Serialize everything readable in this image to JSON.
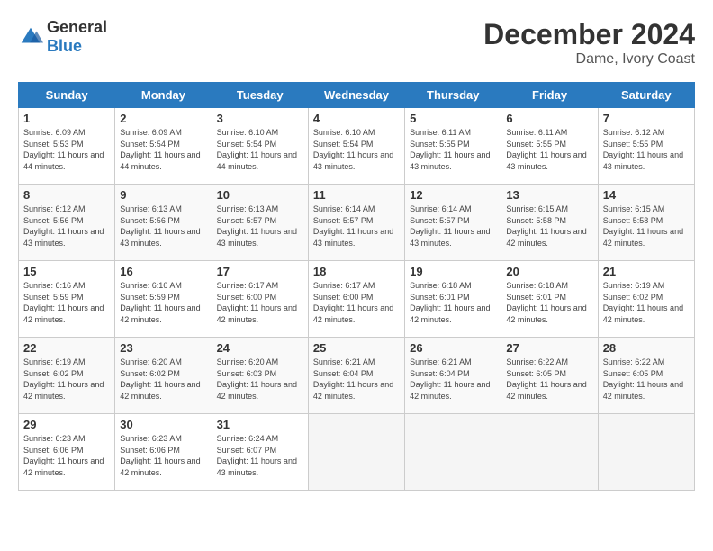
{
  "logo": {
    "general": "General",
    "blue": "Blue"
  },
  "title": "December 2024",
  "location": "Dame, Ivory Coast",
  "days_of_week": [
    "Sunday",
    "Monday",
    "Tuesday",
    "Wednesday",
    "Thursday",
    "Friday",
    "Saturday"
  ],
  "weeks": [
    [
      {
        "day": "1",
        "sunrise": "6:09 AM",
        "sunset": "5:53 PM",
        "daylight": "11 hours and 44 minutes."
      },
      {
        "day": "2",
        "sunrise": "6:09 AM",
        "sunset": "5:54 PM",
        "daylight": "11 hours and 44 minutes."
      },
      {
        "day": "3",
        "sunrise": "6:10 AM",
        "sunset": "5:54 PM",
        "daylight": "11 hours and 44 minutes."
      },
      {
        "day": "4",
        "sunrise": "6:10 AM",
        "sunset": "5:54 PM",
        "daylight": "11 hours and 43 minutes."
      },
      {
        "day": "5",
        "sunrise": "6:11 AM",
        "sunset": "5:55 PM",
        "daylight": "11 hours and 43 minutes."
      },
      {
        "day": "6",
        "sunrise": "6:11 AM",
        "sunset": "5:55 PM",
        "daylight": "11 hours and 43 minutes."
      },
      {
        "day": "7",
        "sunrise": "6:12 AM",
        "sunset": "5:55 PM",
        "daylight": "11 hours and 43 minutes."
      }
    ],
    [
      {
        "day": "8",
        "sunrise": "6:12 AM",
        "sunset": "5:56 PM",
        "daylight": "11 hours and 43 minutes."
      },
      {
        "day": "9",
        "sunrise": "6:13 AM",
        "sunset": "5:56 PM",
        "daylight": "11 hours and 43 minutes."
      },
      {
        "day": "10",
        "sunrise": "6:13 AM",
        "sunset": "5:57 PM",
        "daylight": "11 hours and 43 minutes."
      },
      {
        "day": "11",
        "sunrise": "6:14 AM",
        "sunset": "5:57 PM",
        "daylight": "11 hours and 43 minutes."
      },
      {
        "day": "12",
        "sunrise": "6:14 AM",
        "sunset": "5:57 PM",
        "daylight": "11 hours and 43 minutes."
      },
      {
        "day": "13",
        "sunrise": "6:15 AM",
        "sunset": "5:58 PM",
        "daylight": "11 hours and 42 minutes."
      },
      {
        "day": "14",
        "sunrise": "6:15 AM",
        "sunset": "5:58 PM",
        "daylight": "11 hours and 42 minutes."
      }
    ],
    [
      {
        "day": "15",
        "sunrise": "6:16 AM",
        "sunset": "5:59 PM",
        "daylight": "11 hours and 42 minutes."
      },
      {
        "day": "16",
        "sunrise": "6:16 AM",
        "sunset": "5:59 PM",
        "daylight": "11 hours and 42 minutes."
      },
      {
        "day": "17",
        "sunrise": "6:17 AM",
        "sunset": "6:00 PM",
        "daylight": "11 hours and 42 minutes."
      },
      {
        "day": "18",
        "sunrise": "6:17 AM",
        "sunset": "6:00 PM",
        "daylight": "11 hours and 42 minutes."
      },
      {
        "day": "19",
        "sunrise": "6:18 AM",
        "sunset": "6:01 PM",
        "daylight": "11 hours and 42 minutes."
      },
      {
        "day": "20",
        "sunrise": "6:18 AM",
        "sunset": "6:01 PM",
        "daylight": "11 hours and 42 minutes."
      },
      {
        "day": "21",
        "sunrise": "6:19 AM",
        "sunset": "6:02 PM",
        "daylight": "11 hours and 42 minutes."
      }
    ],
    [
      {
        "day": "22",
        "sunrise": "6:19 AM",
        "sunset": "6:02 PM",
        "daylight": "11 hours and 42 minutes."
      },
      {
        "day": "23",
        "sunrise": "6:20 AM",
        "sunset": "6:02 PM",
        "daylight": "11 hours and 42 minutes."
      },
      {
        "day": "24",
        "sunrise": "6:20 AM",
        "sunset": "6:03 PM",
        "daylight": "11 hours and 42 minutes."
      },
      {
        "day": "25",
        "sunrise": "6:21 AM",
        "sunset": "6:04 PM",
        "daylight": "11 hours and 42 minutes."
      },
      {
        "day": "26",
        "sunrise": "6:21 AM",
        "sunset": "6:04 PM",
        "daylight": "11 hours and 42 minutes."
      },
      {
        "day": "27",
        "sunrise": "6:22 AM",
        "sunset": "6:05 PM",
        "daylight": "11 hours and 42 minutes."
      },
      {
        "day": "28",
        "sunrise": "6:22 AM",
        "sunset": "6:05 PM",
        "daylight": "11 hours and 42 minutes."
      }
    ],
    [
      {
        "day": "29",
        "sunrise": "6:23 AM",
        "sunset": "6:06 PM",
        "daylight": "11 hours and 42 minutes."
      },
      {
        "day": "30",
        "sunrise": "6:23 AM",
        "sunset": "6:06 PM",
        "daylight": "11 hours and 42 minutes."
      },
      {
        "day": "31",
        "sunrise": "6:24 AM",
        "sunset": "6:07 PM",
        "daylight": "11 hours and 43 minutes."
      },
      null,
      null,
      null,
      null
    ]
  ],
  "labels": {
    "sunrise": "Sunrise:",
    "sunset": "Sunset:",
    "daylight": "Daylight:"
  }
}
